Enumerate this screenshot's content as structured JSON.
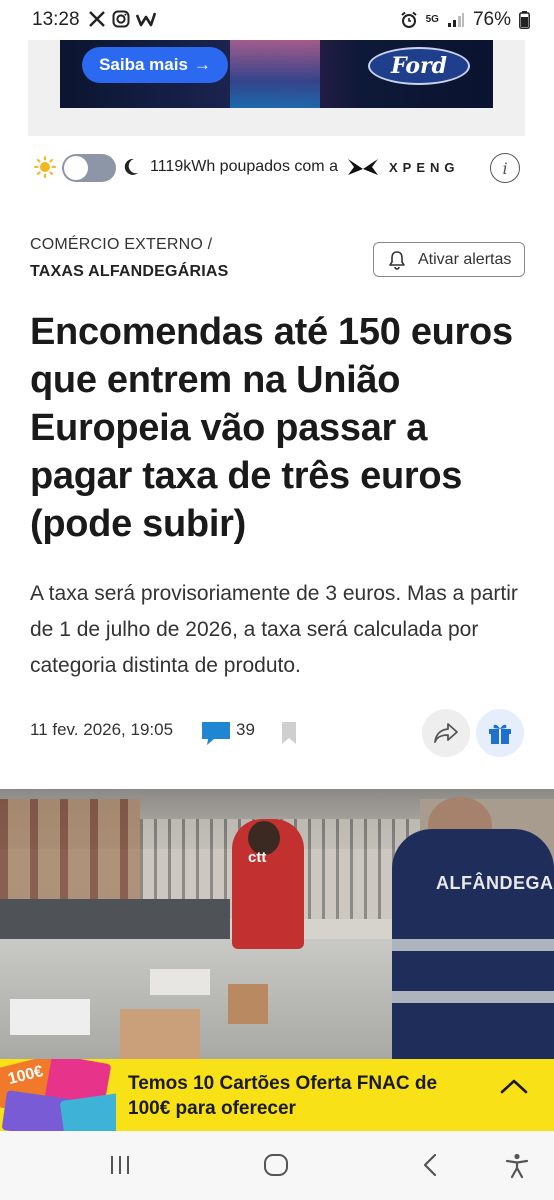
{
  "status_bar": {
    "time": "13:28",
    "battery": "76%",
    "network": "5G",
    "app_icons": [
      "x-icon",
      "instagram-icon",
      "wattpad-icon"
    ],
    "system_icons": [
      "alarm-icon",
      "signal-icon",
      "battery-icon"
    ]
  },
  "ad": {
    "cta_label": "Saiba mais",
    "cta_arrow": "→",
    "brand_logo_text": "Ford"
  },
  "energy": {
    "text": "1119kWh poupados com a",
    "brand": "XPENG",
    "info_glyph": "i",
    "mode_toggle_icons": [
      "sun-icon",
      "moon-icon"
    ]
  },
  "article": {
    "section": "COMÉRCIO EXTERNO /",
    "subsection": "TAXAS ALFANDEGÁRIAS",
    "alert_button_label": "Ativar alertas",
    "headline": "Encomendas até 150 euros que entrem na União Europeia vão passar a pagar taxa de três euros (pode subir)",
    "lead": "A taxa será provisoriamente de 3 euros. Mas a partir de 1 de julho de 2026, a taxa será calculada por categoria distinta de produto.",
    "date": "11 fev. 2026, 19:05",
    "comment_count": "39"
  },
  "photo": {
    "vest_text": "ALFÂNDEGA",
    "shirt_text": "ctt"
  },
  "promo": {
    "text": "Temos 10 Cartões Oferta FNAC de 100€ para oferecer",
    "card_text": "100€"
  },
  "colors": {
    "accent_blue": "#2a69f0",
    "comment_blue": "#1f86d4",
    "promo_yellow": "#f8e116"
  }
}
